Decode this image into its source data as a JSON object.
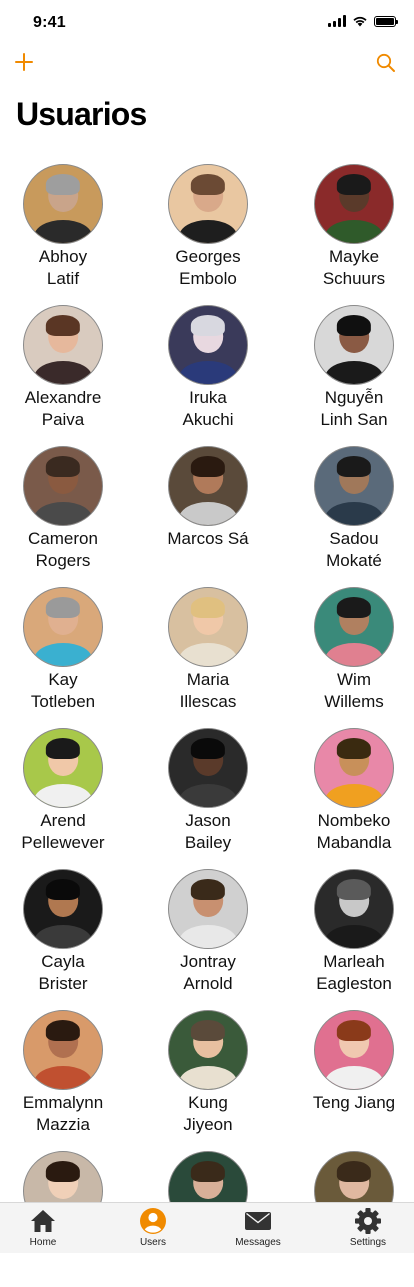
{
  "status_bar": {
    "time": "9:41"
  },
  "header": {
    "title": "Usuarios",
    "add_icon": "plus-icon",
    "search_icon": "search-icon"
  },
  "colors": {
    "accent": "#f08a00",
    "tab_bar_bg": "#f4f4f4"
  },
  "users": [
    {
      "first": "Abhoy",
      "last": "Latif",
      "bg": "#c89a5c",
      "skin": "#c9a48a",
      "shirt": "#2a2a2a",
      "hair": "#9e9e9e"
    },
    {
      "first": "Georges",
      "last": "Embolo",
      "bg": "#e9c7a1",
      "skin": "#d9a98a",
      "shirt": "#1e1e1e",
      "hair": "#6b4a34"
    },
    {
      "first": "Mayke",
      "last": "Schuurs",
      "bg": "#8a2a2a",
      "skin": "#5a3a2a",
      "shirt": "#2f5a2a",
      "hair": "#1a1a1a"
    },
    {
      "first": "Alexandre",
      "last": "Paiva",
      "bg": "#d9cbbf",
      "skin": "#e6b89c",
      "shirt": "#3a2a2a",
      "hair": "#5a3624"
    },
    {
      "first": "Iruka",
      "last": "Akuchi",
      "bg": "#3a3a5a",
      "skin": "#e8d8e0",
      "shirt": "#2a3a7a",
      "hair": "#d8d8e0"
    },
    {
      "first": "Nguyễn",
      "last": "Linh San",
      "bg": "#d8d8d8",
      "skin": "#8a5a44",
      "shirt": "#1a1a1a",
      "hair": "#101010"
    },
    {
      "first": "Cameron",
      "last": "Rogers",
      "bg": "#7a5a4a",
      "skin": "#8a5a40",
      "shirt": "#4a4a4a",
      "hair": "#3a2a20"
    },
    {
      "first": "Marcos Sá",
      "last": "",
      "bg": "#5a4a3a",
      "skin": "#b07a5a",
      "shirt": "#c9c9c9",
      "hair": "#2a1a10"
    },
    {
      "first": "Sadou",
      "last": "Mokaté",
      "bg": "#5a6a7a",
      "skin": "#a0785a",
      "shirt": "#2a3a4a",
      "hair": "#1a1a1a"
    },
    {
      "first": "Kay",
      "last": "Totleben",
      "bg": "#d9a87a",
      "skin": "#e0b090",
      "shirt": "#3ab0d0",
      "hair": "#9a9a9a"
    },
    {
      "first": "Maria",
      "last": "Illescas",
      "bg": "#d8c0a0",
      "skin": "#f0c8a8",
      "shirt": "#e8e0d0",
      "hair": "#e0c080"
    },
    {
      "first": "Wim",
      "last": "Willems",
      "bg": "#3a8a7a",
      "skin": "#b08060",
      "shirt": "#e08090",
      "hair": "#1a1a1a"
    },
    {
      "first": "Arend",
      "last": "Pellewever",
      "bg": "#a8c84a",
      "skin": "#f0c8a8",
      "shirt": "#f0f0f0",
      "hair": "#1a1a1a"
    },
    {
      "first": "Jason",
      "last": "Bailey",
      "bg": "#2a2a2a",
      "skin": "#5a3a2a",
      "shirt": "#3a3a3a",
      "hair": "#0a0a0a"
    },
    {
      "first": "Nombeko",
      "last": "Mabandla",
      "bg": "#e888a8",
      "skin": "#c8905a",
      "shirt": "#f0a020",
      "hair": "#3a2a10"
    },
    {
      "first": "Cayla",
      "last": "Brister",
      "bg": "#1a1a1a",
      "skin": "#b07850",
      "shirt": "#3a3a3a",
      "hair": "#0a0a0a"
    },
    {
      "first": "Jontray",
      "last": "Arnold",
      "bg": "#d0d0d0",
      "skin": "#c89070",
      "shirt": "#e8e8e8",
      "hair": "#3a2a1a"
    },
    {
      "first": "Marleah",
      "last": "Eagleston",
      "bg": "#2a2a2a",
      "skin": "#c8c8c8",
      "shirt": "#1a1a1a",
      "hair": "#5a5a5a"
    },
    {
      "first": "Emmalynn",
      "last": "Mazzia",
      "bg": "#d89a6a",
      "skin": "#b07050",
      "shirt": "#c05030",
      "hair": "#2a1a10"
    },
    {
      "first": "Kung",
      "last": "Jiyeon",
      "bg": "#3a5a3a",
      "skin": "#e8c0a0",
      "shirt": "#e8e0d0",
      "hair": "#5a4a3a"
    },
    {
      "first": "Teng Jiang",
      "last": "",
      "bg": "#e07090",
      "skin": "#f0c8b0",
      "shirt": "#f0f0f0",
      "hair": "#8a3a1a"
    },
    {
      "first": "",
      "last": "",
      "bg": "#c8b8a8",
      "skin": "#f0d0b8",
      "shirt": "#d0d0d0",
      "hair": "#2a1a10"
    },
    {
      "first": "",
      "last": "",
      "bg": "#2a4a3a",
      "skin": "#d8b098",
      "shirt": "#3a3a3a",
      "hair": "#3a2a1a"
    },
    {
      "first": "",
      "last": "",
      "bg": "#6a5a3a",
      "skin": "#e0b8a0",
      "shirt": "#4a4a4a",
      "hair": "#3a2a1a"
    }
  ],
  "tabs": [
    {
      "label": "Home",
      "icon": "house-icon",
      "active": false
    },
    {
      "label": "Users",
      "icon": "user-circle-icon",
      "active": true
    },
    {
      "label": "Messages",
      "icon": "envelope-icon",
      "active": false
    },
    {
      "label": "Settings",
      "icon": "gear-icon",
      "active": false
    }
  ]
}
